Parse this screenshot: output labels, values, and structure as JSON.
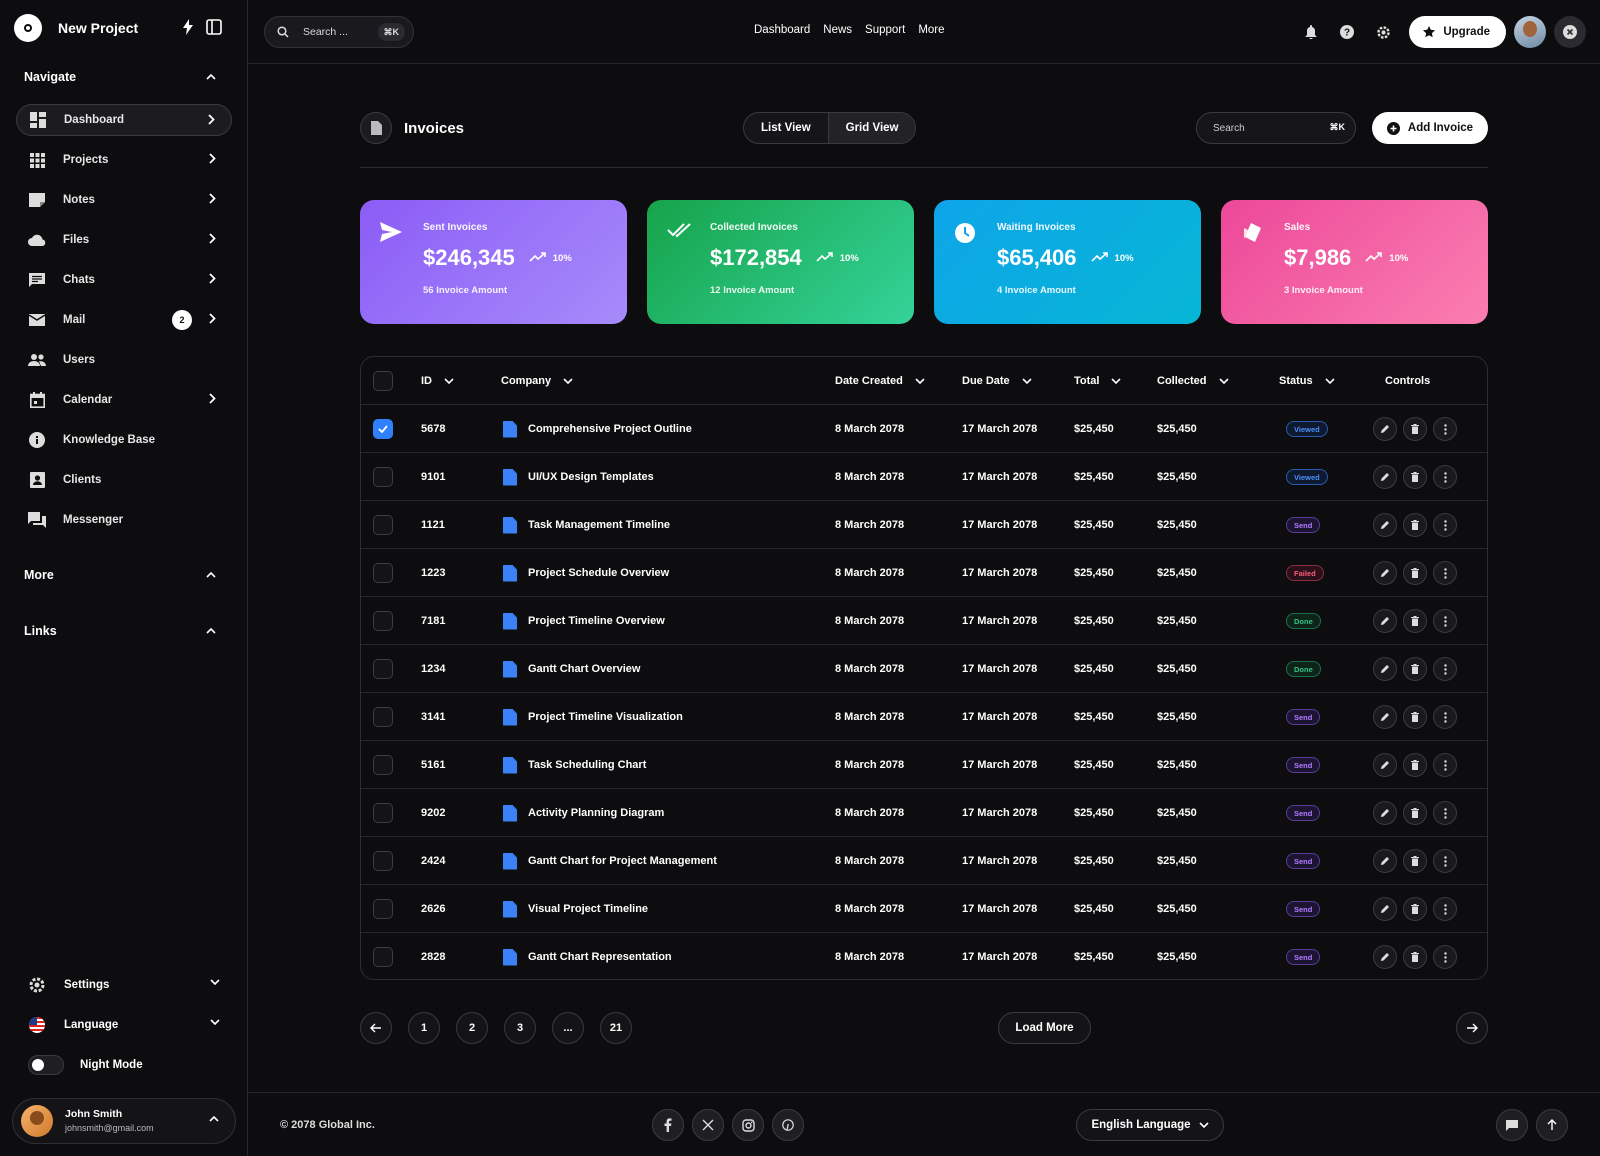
{
  "app": {
    "name": "New Project"
  },
  "sidebar": {
    "navigate_label": "Navigate",
    "items": [
      {
        "label": "Dashboard",
        "icon": "dashboard-icon"
      },
      {
        "label": "Projects",
        "icon": "grid-icon"
      },
      {
        "label": "Notes",
        "icon": "note-icon"
      },
      {
        "label": "Files",
        "icon": "cloud-icon"
      },
      {
        "label": "Chats",
        "icon": "chat-icon"
      },
      {
        "label": "Mail",
        "icon": "mail-icon",
        "badge": "2"
      },
      {
        "label": "Users",
        "icon": "users-icon"
      },
      {
        "label": "Calendar",
        "icon": "calendar-icon"
      },
      {
        "label": "Knowledge Base",
        "icon": "info-icon"
      },
      {
        "label": "Clients",
        "icon": "contact-icon"
      },
      {
        "label": "Messenger",
        "icon": "forum-icon"
      }
    ],
    "more_label": "More",
    "links_label": "Links",
    "settings_label": "Settings",
    "language_label": "Language",
    "night_mode_label": "Night Mode",
    "user": {
      "name": "John Smith",
      "email": "johnsmith@gmail.com"
    }
  },
  "topbar": {
    "search_placeholder": "Search ...",
    "search_shortcut": "⌘K",
    "links": [
      "Dashboard",
      "News",
      "Support",
      "More"
    ],
    "upgrade_label": "Upgrade"
  },
  "page": {
    "title": "Invoices",
    "list_view_label": "List View",
    "grid_view_label": "Grid View",
    "search_placeholder": "Search",
    "search_shortcut": "⌘K",
    "add_label": "Add Invoice"
  },
  "cards": [
    {
      "label": "Sent Invoices",
      "amount": "$246,345",
      "pct": "10%",
      "sub": "56 Invoice Amount",
      "gradient": [
        "#8b5cf6",
        "#a78bfa"
      ],
      "icon": "send-icon"
    },
    {
      "label": "Collected Invoices",
      "amount": "$172,854",
      "pct": "10%",
      "sub": "12 Invoice Amount",
      "gradient": [
        "#16a34a",
        "#34d399"
      ],
      "icon": "double-check-icon"
    },
    {
      "label": "Waiting Invoices",
      "amount": "$65,406",
      "pct": "10%",
      "sub": "4 Invoice Amount",
      "gradient": [
        "#0ea5e9",
        "#06b6d4"
      ],
      "icon": "clock-icon"
    },
    {
      "label": "Sales",
      "amount": "$7,986",
      "pct": "10%",
      "sub": "3 Invoice Amount",
      "gradient": [
        "#ec4899",
        "#fb7eb0"
      ],
      "icon": "tag-icon"
    }
  ],
  "table": {
    "headers": {
      "id": "ID",
      "company": "Company",
      "date_created": "Date Created",
      "due_date": "Due Date",
      "total": "Total",
      "collected": "Collected",
      "status": "Status",
      "controls": "Controls"
    },
    "rows": [
      {
        "id": "5678",
        "company": "Comprehensive Project Outline",
        "created": "8 March 2078",
        "due": "17 March 2078",
        "total": "$25,450",
        "collected": "$25,450",
        "status": "Viewed",
        "checked": true
      },
      {
        "id": "9101",
        "company": "UI/UX Design Templates",
        "created": "8 March 2078",
        "due": "17 March 2078",
        "total": "$25,450",
        "collected": "$25,450",
        "status": "Viewed",
        "checked": false
      },
      {
        "id": "1121",
        "company": "Task Management Timeline",
        "created": "8 March 2078",
        "due": "17 March 2078",
        "total": "$25,450",
        "collected": "$25,450",
        "status": "Send",
        "checked": false
      },
      {
        "id": "1223",
        "company": "Project Schedule Overview",
        "created": "8 March 2078",
        "due": "17 March 2078",
        "total": "$25,450",
        "collected": "$25,450",
        "status": "Failed",
        "checked": false
      },
      {
        "id": "7181",
        "company": "Project Timeline Overview",
        "created": "8 March 2078",
        "due": "17 March 2078",
        "total": "$25,450",
        "collected": "$25,450",
        "status": "Done",
        "checked": false
      },
      {
        "id": "1234",
        "company": "Gantt Chart Overview",
        "created": "8 March 2078",
        "due": "17 March 2078",
        "total": "$25,450",
        "collected": "$25,450",
        "status": "Done",
        "checked": false
      },
      {
        "id": "3141",
        "company": "Project Timeline Visualization",
        "created": "8 March 2078",
        "due": "17 March 2078",
        "total": "$25,450",
        "collected": "$25,450",
        "status": "Send",
        "checked": false
      },
      {
        "id": "5161",
        "company": "Task Scheduling Chart",
        "created": "8 March 2078",
        "due": "17 March 2078",
        "total": "$25,450",
        "collected": "$25,450",
        "status": "Send",
        "checked": false
      },
      {
        "id": "9202",
        "company": "Activity Planning Diagram",
        "created": "8 March 2078",
        "due": "17 March 2078",
        "total": "$25,450",
        "collected": "$25,450",
        "status": "Send",
        "checked": false
      },
      {
        "id": "2424",
        "company": "Gantt Chart for Project Management",
        "created": "8 March 2078",
        "due": "17 March 2078",
        "total": "$25,450",
        "collected": "$25,450",
        "status": "Send",
        "checked": false
      },
      {
        "id": "2626",
        "company": "Visual Project Timeline",
        "created": "8 March 2078",
        "due": "17 March 2078",
        "total": "$25,450",
        "collected": "$25,450",
        "status": "Send",
        "checked": false
      },
      {
        "id": "2828",
        "company": "Gantt Chart Representation",
        "created": "8 March 2078",
        "due": "17 March 2078",
        "total": "$25,450",
        "collected": "$25,450",
        "status": "Send",
        "checked": false
      }
    ]
  },
  "pagination": {
    "pages": [
      "1",
      "2",
      "3",
      "...",
      "21"
    ],
    "load_more": "Load More"
  },
  "footer": {
    "copyright": "© 2078 Global Inc.",
    "language": "English Language",
    "socials": [
      "facebook-icon",
      "x-icon",
      "instagram-icon",
      "pinterest-icon"
    ]
  }
}
